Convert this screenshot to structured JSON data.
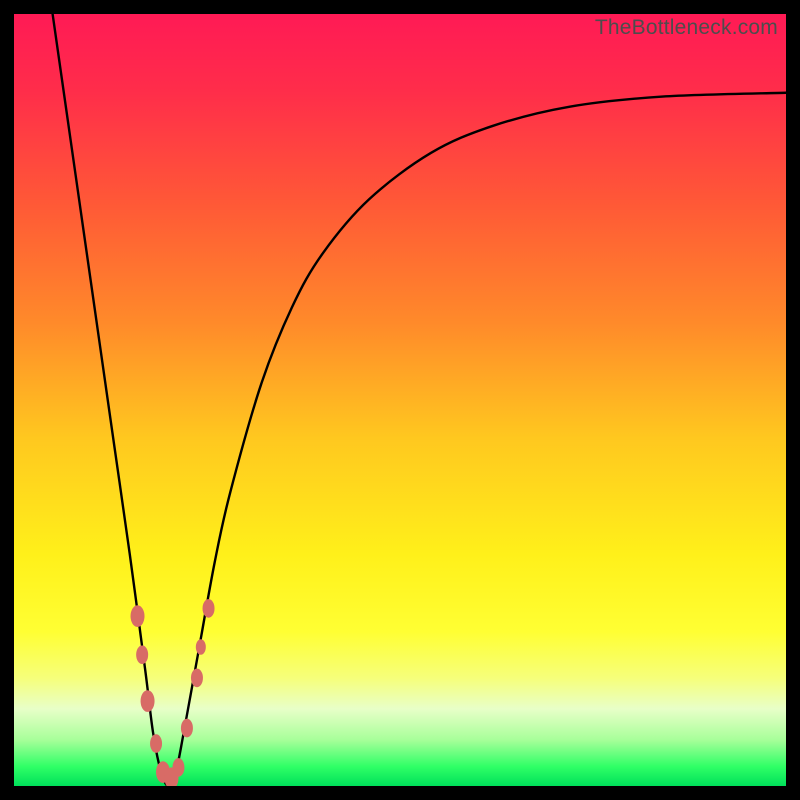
{
  "watermark": "TheBottleneck.com",
  "colors": {
    "border": "#000000",
    "gradient_stops": [
      {
        "pos": 0.0,
        "color": "#ff1a55"
      },
      {
        "pos": 0.1,
        "color": "#ff2d4a"
      },
      {
        "pos": 0.25,
        "color": "#ff5a36"
      },
      {
        "pos": 0.4,
        "color": "#ff8a2a"
      },
      {
        "pos": 0.55,
        "color": "#ffc81f"
      },
      {
        "pos": 0.7,
        "color": "#fff01a"
      },
      {
        "pos": 0.8,
        "color": "#ffff33"
      },
      {
        "pos": 0.86,
        "color": "#f6ff7a"
      },
      {
        "pos": 0.9,
        "color": "#e8ffc8"
      },
      {
        "pos": 0.94,
        "color": "#a8ff9a"
      },
      {
        "pos": 0.975,
        "color": "#2fff66"
      },
      {
        "pos": 1.0,
        "color": "#00e05a"
      }
    ],
    "curve": "#000000",
    "marker_fill": "#d86b66",
    "marker_stroke": "#b84e49"
  },
  "chart_data": {
    "type": "line",
    "title": "",
    "xlabel": "",
    "ylabel": "",
    "xlim": [
      0,
      100
    ],
    "ylim": [
      0,
      100
    ],
    "note": "Single unlabeled curve; y=100 at top (red), y=0 at bottom (green). x is 0..100 left→right. Curve is a deep notch near x≈20 rising asymptotically to the right.",
    "series": [
      {
        "name": "curve",
        "x": [
          5,
          7,
          9,
          11,
          13,
          15,
          17,
          18,
          19,
          20,
          21,
          22,
          24,
          26,
          28,
          32,
          36,
          40,
          46,
          54,
          62,
          72,
          84,
          100
        ],
        "y": [
          100,
          86,
          72,
          58,
          44,
          30,
          15,
          7,
          2,
          0,
          2,
          7,
          18,
          29,
          38,
          52,
          62,
          69,
          76,
          82,
          85.5,
          88,
          89.3,
          89.8
        ]
      }
    ],
    "markers": [
      {
        "x": 16.0,
        "y": 22,
        "r": 7
      },
      {
        "x": 16.6,
        "y": 17,
        "r": 6
      },
      {
        "x": 17.3,
        "y": 11,
        "r": 7
      },
      {
        "x": 18.4,
        "y": 5.5,
        "r": 6
      },
      {
        "x": 19.3,
        "y": 1.8,
        "r": 7
      },
      {
        "x": 20.4,
        "y": 1.0,
        "r": 7
      },
      {
        "x": 21.3,
        "y": 2.4,
        "r": 6
      },
      {
        "x": 22.4,
        "y": 7.5,
        "r": 6
      },
      {
        "x": 23.7,
        "y": 14,
        "r": 6
      },
      {
        "x": 24.2,
        "y": 18,
        "r": 5
      },
      {
        "x": 25.2,
        "y": 23,
        "r": 6
      }
    ]
  }
}
